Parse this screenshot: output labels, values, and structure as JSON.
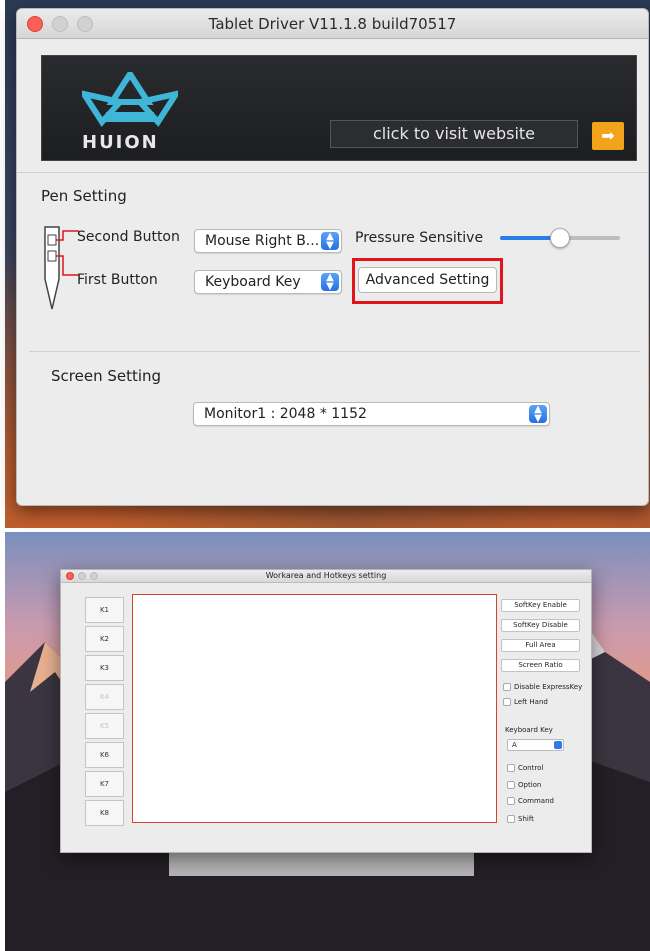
{
  "top_window": {
    "title": "Tablet Driver V11.1.8 build70517",
    "banner": {
      "brand": "HUION",
      "visit_label": "click to visit website",
      "visit_arrow": "➡"
    },
    "pen_setting": {
      "heading": "Pen Setting",
      "second_button_label": "Second Button",
      "first_button_label": "First Button",
      "second_button_value": "Mouse Right B...",
      "first_button_value": "Keyboard Key",
      "pressure_label": "Pressure Sensitive",
      "pressure_level": 0.5,
      "advanced_button": "Advanced Setting"
    },
    "screen_setting": {
      "heading": "Screen Setting",
      "monitor_value": "Monitor1 : 2048 * 1152"
    }
  },
  "bottom_window": {
    "title": "Workarea and Hotkeys setting",
    "keys": [
      {
        "label": "K1",
        "enabled": true
      },
      {
        "label": "K2",
        "enabled": true
      },
      {
        "label": "K3",
        "enabled": true
      },
      {
        "label": "K4",
        "enabled": false
      },
      {
        "label": "K5",
        "enabled": false
      },
      {
        "label": "K6",
        "enabled": true
      },
      {
        "label": "K7",
        "enabled": true
      },
      {
        "label": "K8",
        "enabled": true
      }
    ],
    "buttons": [
      "SoftKey Enable",
      "SoftKey Disable",
      "Full Area",
      "Screen Ratio"
    ],
    "checks": [
      "Disable ExpressKey",
      "Left Hand"
    ],
    "keyboard_key_label": "Keyboard Key",
    "keyboard_key_value": "A",
    "modifiers": [
      "Control",
      "Option",
      "Command",
      "Shift"
    ]
  },
  "colors": {
    "highlight": "#e0151b",
    "accent_blue": "#2a7de8",
    "visit_arrow": "#f2a21b",
    "workarea_border": "#d4432e"
  },
  "icons": {
    "select_chevron": "up-down-chevron-icon",
    "pen": "pen-diagram-icon",
    "logo": "huion-crown-logo"
  }
}
